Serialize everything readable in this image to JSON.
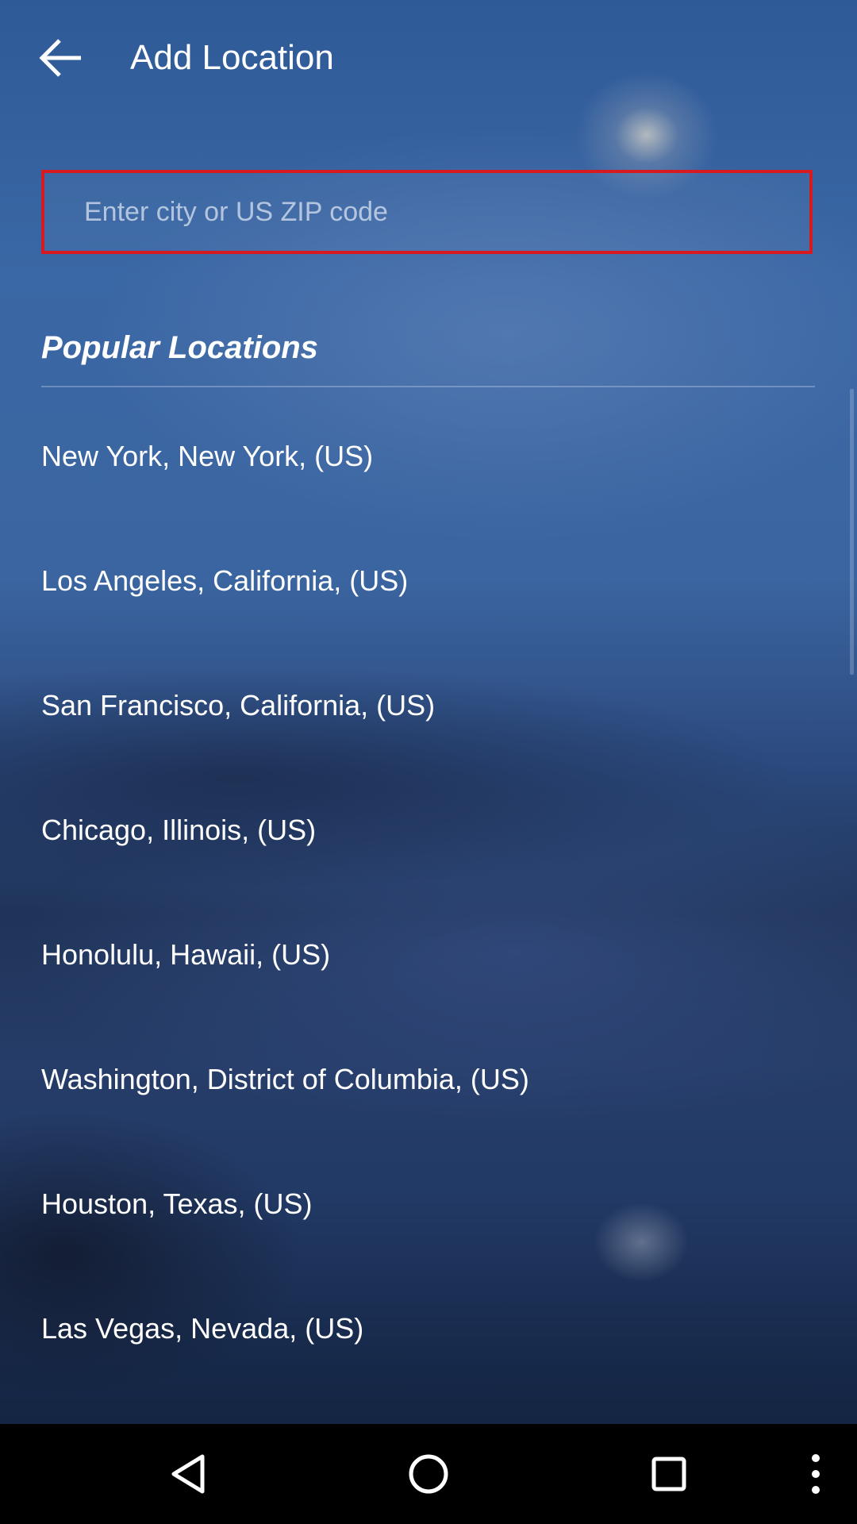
{
  "app_bar": {
    "back_icon": "arrow-back-icon",
    "title": "Add Location"
  },
  "search": {
    "placeholder": "Enter city or US ZIP code",
    "value": "",
    "border_color": "#d71920"
  },
  "popular": {
    "heading": "Popular Locations",
    "items": [
      "New York, New York, (US)",
      "Los Angeles, California, (US)",
      "San Francisco, California, (US)",
      "Chicago, Illinois, (US)",
      "Honolulu, Hawaii, (US)",
      "Washington, District of Columbia, (US)",
      "Houston, Texas, (US)",
      "Las Vegas, Nevada, (US)"
    ]
  },
  "nav_bar": {
    "back_icon": "triangle-back-icon",
    "home_icon": "circle-home-icon",
    "recents_icon": "square-recents-icon",
    "menu_icon": "overflow-menu-icon"
  }
}
